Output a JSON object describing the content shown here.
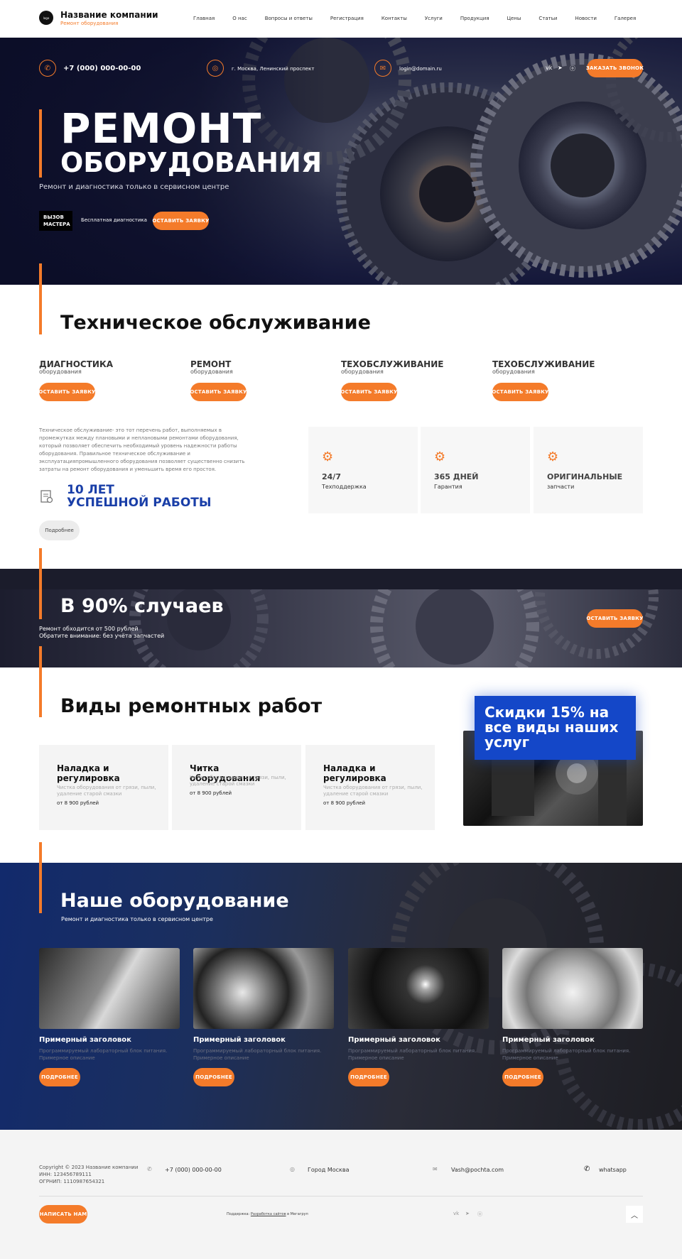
{
  "header": {
    "logo_text": "logo",
    "company_name": "Название компании",
    "company_sub": "Ремонт оборудования",
    "nav": [
      "Главная",
      "О нас",
      "Вопросы и ответы",
      "Регистрация",
      "Контакты",
      "Услуги",
      "Продукция",
      "Цены",
      "Статьи",
      "Новости",
      "Галерея"
    ]
  },
  "hero": {
    "phone": "+7 (000) 000-00-00",
    "address": "г. Москва, Ленинский проспект",
    "email": "login@domain.ru",
    "social": [
      "vk-icon",
      "telegram-icon",
      "odnoklassniki-icon"
    ],
    "order_button": "ЗАКАЗАТЬ ЗВОНОК",
    "title_line1": "РЕМОНТ",
    "title_line2": "ОБОРУДОВАНИЯ",
    "subtitle": "Ремонт и диагностика только в сервисном центре",
    "call_badge": "ВЫЗОВ МАСТЕРА",
    "free_diag": "Бесплатная диагностика",
    "leave_request": "ОСТАВИТЬ ЗАЯВКУ"
  },
  "maintenance": {
    "title": "Техническое обслуживание",
    "features": [
      {
        "title": "ДИАГНОСТИКА",
        "sub": "оборудования",
        "button": "ОСТАВИТЬ ЗАЯВКУ"
      },
      {
        "title": "РЕМОНТ",
        "sub": "оборудования",
        "button": "ОСТАВИТЬ ЗАЯВКУ"
      },
      {
        "title": "ТЕХОБСЛУЖИВАНИЕ",
        "sub": "оборудования",
        "button": "ОСТАВИТЬ ЗАЯВКУ"
      },
      {
        "title": "ТЕХОБСЛУЖИВАНИЕ",
        "sub": "оборудования",
        "button": "ОСТАВИТЬ ЗАЯВКУ"
      }
    ],
    "description": "Техническое обслуживание- это тот перечень работ, выполняемых в промежутках между плановыми и неплановыми ремонтами оборудования, который позволяет обеспечить необходимый уровень надежности работы оборудования. Правильное техническое обслуживание и эксплуатацияпромышленного оборудования позволяет существенно снизить затраты на ремонт оборудования и уменьшить время его простоя.",
    "years_line1": "10 ЛЕТ",
    "years_line2": "УСПЕШНОЙ РАБОТЫ",
    "more_button": "Подробнее",
    "stats": [
      {
        "value": "24/7",
        "label": "Техподдержка"
      },
      {
        "value": "365 ДНЕЙ",
        "label": "Гарантия"
      },
      {
        "value": "ОРИГИНАЛЬНЫЕ",
        "label": "запчасти"
      }
    ]
  },
  "band": {
    "title": "В 90% случаев",
    "line1": "Ремонт обходится от 500 рублей",
    "line2": "Обратите внимание: без учёта запчастей",
    "button": "ОСТАВИТЬ ЗАЯВКУ"
  },
  "repairs": {
    "title": "Виды ремонтных работ",
    "cards": [
      {
        "title": "Наладка и регулировка",
        "desc": "Чистка оборудования от грязи, пыли, удаление старой смазки",
        "price": "от 8 900 рублей"
      },
      {
        "title": "Читка оборудования",
        "desc": "Читка оборудования от грязи, пыли, удаление старой смазки",
        "price": "от 8 900 рублей"
      },
      {
        "title": "Наладка и регулировка",
        "desc": "Чистка оборудования от грязи, пыли, удаление старой смазки",
        "price": "от 8 900 рублей"
      }
    ],
    "promo": "Скидки 15% на все виды наших услуг"
  },
  "equipment": {
    "title": "Наше оборудование",
    "subtitle": "Ремонт и диагностика только в сервисном центре",
    "items": [
      {
        "title": "Примерный заголовок",
        "desc": "Программируемый лабораторный блок питания. Примерное описание",
        "button": "ПОДРОБНЕЕ"
      },
      {
        "title": "Примерный заголовок",
        "desc": "Программируемый лабораторный блок питания. Примерное описание",
        "button": "ПОДРОБНЕЕ"
      },
      {
        "title": "Примерный заголовок",
        "desc": "Программируемый лабораторный блок питания. Примерное описание",
        "button": "ПОДРОБНЕЕ"
      },
      {
        "title": "Примерный заголовок",
        "desc": "Программируемый лабораторный блок питания. Примерное описание",
        "button": "ПОДРОБНЕЕ"
      }
    ]
  },
  "footer": {
    "copyright": "Copyright © 2023 Название компании",
    "inn": "ИНН: 123456789111",
    "ogrn": "ОГРНИП: 1110987654321",
    "phone": "+7 (000) 000-00-00",
    "city": "Город Москва",
    "email": "Vash@pochta.com",
    "whatsapp": "whatsapp",
    "write_button": "НАПИСАТЬ НАМ",
    "credit_prefix": "Поддержка: ",
    "credit_link": "Разработка сайтов",
    "credit_suffix": " в Мегагруп"
  },
  "colors": {
    "accent": "#f47b2a",
    "promo_blue": "#1447c8",
    "years_blue": "#1a3fa8"
  }
}
